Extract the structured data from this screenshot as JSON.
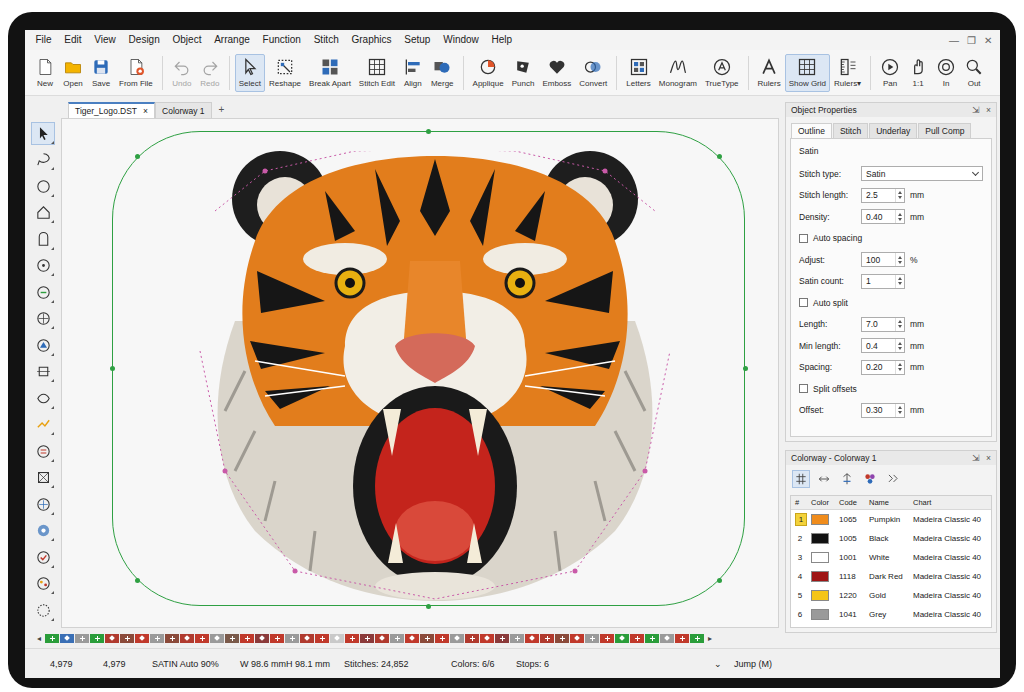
{
  "window": {
    "controls": [
      "—",
      "❐",
      "✕"
    ]
  },
  "menu": [
    "File",
    "Edit",
    "View",
    "Design",
    "Object",
    "Arrange",
    "Function",
    "Stitch",
    "Graphics",
    "Setup",
    "Window",
    "Help"
  ],
  "toolbar": {
    "groups": [
      [
        {
          "label": "New",
          "selected": false,
          "disabled": false
        },
        {
          "label": "Open",
          "selected": false,
          "disabled": false
        },
        {
          "label": "Save",
          "selected": false,
          "disabled": false
        },
        {
          "label": "From File",
          "selected": false,
          "disabled": false
        }
      ],
      [
        {
          "label": "Undo",
          "selected": false,
          "disabled": true
        },
        {
          "label": "Redo",
          "selected": false,
          "disabled": true
        }
      ],
      [
        {
          "label": "Select",
          "selected": true,
          "disabled": false
        },
        {
          "label": "Reshape",
          "selected": false,
          "disabled": false
        },
        {
          "label": "Break Apart",
          "selected": false,
          "disabled": false
        },
        {
          "label": "Stitch Edit",
          "selected": false,
          "disabled": false
        },
        {
          "label": "Align",
          "selected": false,
          "disabled": false
        },
        {
          "label": "Merge",
          "selected": false,
          "disabled": false
        }
      ],
      [
        {
          "label": "Applique",
          "selected": false,
          "disabled": false
        },
        {
          "label": "Punch",
          "selected": false,
          "disabled": false
        },
        {
          "label": "Emboss",
          "selected": false,
          "disabled": false
        },
        {
          "label": "Convert",
          "selected": false,
          "disabled": false
        }
      ],
      [
        {
          "label": "Letters",
          "selected": false,
          "disabled": false
        },
        {
          "label": "Monogram",
          "selected": false,
          "disabled": false
        },
        {
          "label": "TrueType",
          "selected": false,
          "disabled": false
        }
      ],
      [
        {
          "label": "Rulers",
          "selected": false,
          "disabled": false
        },
        {
          "label": "Show Grid",
          "selected": true,
          "disabled": false
        },
        {
          "label": "Rulers",
          "suffix": "▾",
          "selected": false,
          "disabled": false
        }
      ],
      [
        {
          "label": "Pan",
          "selected": false,
          "disabled": false
        },
        {
          "label": "1:1",
          "selected": false,
          "disabled": false
        },
        {
          "label": "In",
          "selected": false,
          "disabled": false
        },
        {
          "label": "Out",
          "selected": false,
          "disabled": false
        }
      ]
    ]
  },
  "doc_tabs": {
    "tabs": [
      {
        "label": "Tiger_Logo.DST",
        "close": "×",
        "selected": true
      },
      {
        "label": "Colorway 1",
        "selected": false
      }
    ],
    "add": "+"
  },
  "tools": [
    {
      "selected": true
    },
    {
      "selected": false
    },
    {
      "selected": false
    },
    {
      "selected": false
    },
    {
      "selected": false
    },
    {
      "selected": false
    },
    {
      "selected": false
    },
    {
      "selected": false
    },
    {
      "selected": false
    },
    {
      "selected": false
    },
    {
      "selected": false
    },
    {
      "selected": false
    },
    {
      "selected": false
    },
    {
      "selected": false
    },
    {
      "selected": false
    },
    {
      "selected": false
    },
    {
      "selected": false
    },
    {
      "selected": false
    },
    {
      "selected": false
    }
  ],
  "properties": {
    "title": "Object Properties",
    "controls": [
      "⇲",
      "×"
    ],
    "tabs": [
      {
        "label": "Outline",
        "selected": true
      },
      {
        "label": "Stitch",
        "selected": false
      },
      {
        "label": "Underlay",
        "selected": false
      },
      {
        "label": "Pull Comp",
        "selected": false
      }
    ],
    "section": "Satin",
    "fields": [
      {
        "kind": "select",
        "label": "Stitch type:",
        "value": "Satin"
      },
      {
        "kind": "spin",
        "label": "Stitch length:",
        "value": "2.5",
        "unit": "mm"
      },
      {
        "kind": "spin",
        "label": "Density:",
        "value": "0.40",
        "unit": "mm"
      },
      {
        "kind": "check",
        "label": "Auto spacing",
        "checked": false
      },
      {
        "kind": "spin",
        "label": "Adjust:",
        "value": "100",
        "unit": "%"
      },
      {
        "kind": "spin",
        "label": "Satin count:",
        "value": "1"
      },
      {
        "kind": "check",
        "label": "Auto split",
        "checked": false
      },
      {
        "kind": "spin",
        "label": "Length:",
        "value": "7.0",
        "unit": "mm"
      },
      {
        "kind": "spin",
        "label": "Min length:",
        "value": "0.4",
        "unit": "mm"
      },
      {
        "kind": "spin",
        "label": "Spacing:",
        "value": "0.20",
        "unit": "mm"
      },
      {
        "kind": "check",
        "label": "Split offsets",
        "checked": false
      },
      {
        "kind": "spin",
        "label": "Offset:",
        "value": "0.30",
        "unit": "mm"
      }
    ]
  },
  "colorway": {
    "title": "Colorway - Colorway 1",
    "controls": [
      "⇲",
      "×"
    ],
    "tools": [
      {
        "selected": true
      },
      {
        "selected": false
      },
      {
        "selected": false
      },
      {
        "selected": false
      },
      {
        "selected": false
      }
    ],
    "columns": [
      "#",
      "Color",
      "Code",
      "Name",
      "Chart"
    ],
    "rows": [
      {
        "num": "1",
        "current": true,
        "color": "#f08c1c",
        "code": "1065",
        "name": "Pumpkin",
        "chart": "Madeira Classic 40"
      },
      {
        "num": "2",
        "current": false,
        "color": "#111111",
        "code": "1005",
        "name": "Black",
        "chart": "Madeira Classic 40"
      },
      {
        "num": "3",
        "current": false,
        "color": "#ffffff",
        "code": "1001",
        "name": "White",
        "chart": "Madeira Classic 40"
      },
      {
        "num": "4",
        "current": false,
        "color": "#9e1414",
        "code": "1118",
        "name": "Dark Red",
        "chart": "Madeira Classic 40"
      },
      {
        "num": "5",
        "current": false,
        "color": "#f5c518",
        "code": "1220",
        "name": "Gold",
        "chart": "Madeira Classic 40"
      },
      {
        "num": "6",
        "current": false,
        "color": "#9a9a9a",
        "code": "1041",
        "name": "Grey",
        "chart": "Madeira Classic 40"
      }
    ]
  },
  "color_strip": {
    "prev": "◂",
    "next": "▸",
    "stops": [
      {
        "color": "#2a9d3a",
        "kind": "plus"
      },
      {
        "color": "#3a6fb5",
        "kind": "diamond"
      },
      {
        "color": "#9a9a9a",
        "kind": "plus"
      },
      {
        "color": "#2a9d3a",
        "kind": "plus"
      },
      {
        "color": "#b03a2e",
        "kind": "diamond"
      },
      {
        "color": "#8b4a3a",
        "kind": "plus"
      },
      {
        "color": "#c0392b",
        "kind": "diamond"
      },
      {
        "color": "#9a9a9a",
        "kind": "plus"
      },
      {
        "color": "#8b4a3a",
        "kind": "plus"
      },
      {
        "color": "#b03a2e",
        "kind": "diamond"
      },
      {
        "color": "#c0392b",
        "kind": "plus"
      },
      {
        "color": "#9a9a9a",
        "kind": "diamond"
      },
      {
        "color": "#7a5a4a",
        "kind": "plus"
      },
      {
        "color": "#c0392b",
        "kind": "plus"
      },
      {
        "color": "#8b3a3a",
        "kind": "diamond"
      },
      {
        "color": "#c0392b",
        "kind": "plus"
      },
      {
        "color": "#9a9a9a",
        "kind": "plus"
      },
      {
        "color": "#b03a2e",
        "kind": "diamond"
      },
      {
        "color": "#c0392b",
        "kind": "plus"
      },
      {
        "color": "#c9c9c9",
        "kind": "diamond"
      },
      {
        "color": "#c0392b",
        "kind": "plus"
      },
      {
        "color": "#8b3a3a",
        "kind": "plus"
      },
      {
        "color": "#b03a2e",
        "kind": "diamond"
      },
      {
        "color": "#9a9a9a",
        "kind": "plus"
      },
      {
        "color": "#c0392b",
        "kind": "diamond"
      },
      {
        "color": "#8b4a3a",
        "kind": "plus"
      },
      {
        "color": "#c0392b",
        "kind": "plus"
      },
      {
        "color": "#9a9a9a",
        "kind": "diamond"
      },
      {
        "color": "#b03a2e",
        "kind": "plus"
      },
      {
        "color": "#c0392b",
        "kind": "diamond"
      },
      {
        "color": "#8b3a3a",
        "kind": "plus"
      },
      {
        "color": "#9a9a9a",
        "kind": "plus"
      },
      {
        "color": "#c0392b",
        "kind": "diamond"
      },
      {
        "color": "#b03a2e",
        "kind": "plus"
      },
      {
        "color": "#8b4a3a",
        "kind": "plus"
      },
      {
        "color": "#c0392b",
        "kind": "diamond"
      },
      {
        "color": "#9a9a9a",
        "kind": "plus"
      },
      {
        "color": "#c0392b",
        "kind": "plus"
      },
      {
        "color": "#2a9d3a",
        "kind": "diamond"
      },
      {
        "color": "#c0392b",
        "kind": "plus"
      },
      {
        "color": "#2a9d3a",
        "kind": "plus"
      },
      {
        "color": "#9a9a9a",
        "kind": "diamond"
      },
      {
        "color": "#c0392b",
        "kind": "plus"
      },
      {
        "color": "#2a9d3a",
        "kind": "plus"
      }
    ]
  },
  "status_bar": [
    "4,979",
    "4,979",
    "SATIN Auto 90%",
    "W 98.6 mm",
    "H 98.1 mm",
    "Stitches: 24,852",
    "Colors: 6/6",
    "Stops: 6",
    "⌄",
    "Jump (M)"
  ]
}
